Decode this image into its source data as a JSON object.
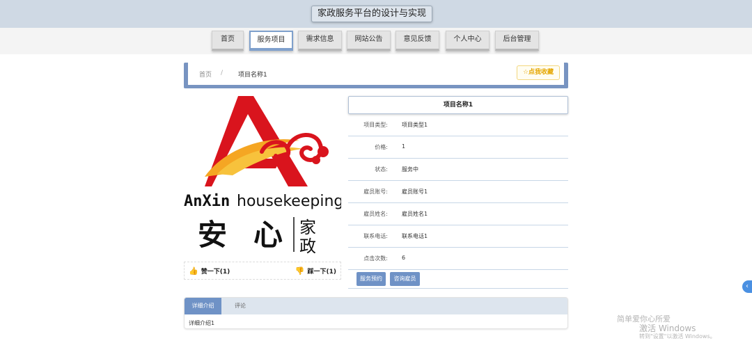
{
  "header": {
    "title": "家政服务平台的设计与实现"
  },
  "nav": {
    "items": [
      {
        "label": "首页"
      },
      {
        "label": "服务项目"
      },
      {
        "label": "需求信息"
      },
      {
        "label": "网站公告"
      },
      {
        "label": "意见反馈"
      },
      {
        "label": "个人中心"
      },
      {
        "label": "后台管理"
      }
    ],
    "active": "服务项目"
  },
  "breadcrumb": {
    "home": "首页",
    "separator": "/",
    "current": "项目名称1"
  },
  "favorite": {
    "icon": "star-outline-icon",
    "label": "☆点我收藏"
  },
  "logo": {
    "text_en_1": "AnXin",
    "text_en_2": "housekeeping",
    "text_cn_1": "安",
    "text_cn_2": "心",
    "text_cn_3": "家",
    "text_cn_4": "政"
  },
  "votes": {
    "up_icon": "thumbs-up-icon",
    "up_label": "赞一下(1)",
    "down_icon": "thumbs-down-icon",
    "down_label": "踩一下(1)"
  },
  "detail": {
    "title": "项目名称1",
    "rows": [
      {
        "label": "项目类型:",
        "value": "项目类型1"
      },
      {
        "label": "价格:",
        "value": "1"
      },
      {
        "label": "状态:",
        "value": "服务中"
      },
      {
        "label": "雇员账号:",
        "value": "雇员账号1"
      },
      {
        "label": "雇员姓名:",
        "value": "雇员姓名1"
      },
      {
        "label": "联系电话:",
        "value": "联系电话1"
      },
      {
        "label": "点击次数:",
        "value": "6"
      }
    ]
  },
  "actions": {
    "book": "服务预约",
    "consult": "咨询雇员"
  },
  "tabs": {
    "items": [
      {
        "label": "详细介绍"
      },
      {
        "label": "评论"
      }
    ],
    "active": "详细介绍",
    "content": "详细介绍1"
  },
  "side_button": {
    "icon": "chevron-left-icon",
    "glyph": "‹"
  },
  "watermark": {
    "line1": "简单爱你心所爱",
    "line2": "激活 Windows",
    "line3": "转到\"设置\"以激活 Windows。"
  },
  "colors": {
    "accent": "#6f92c6",
    "nav_active_border": "#7fa0cc",
    "logo_red": "#d9141d",
    "logo_orange": "#f5a623"
  }
}
